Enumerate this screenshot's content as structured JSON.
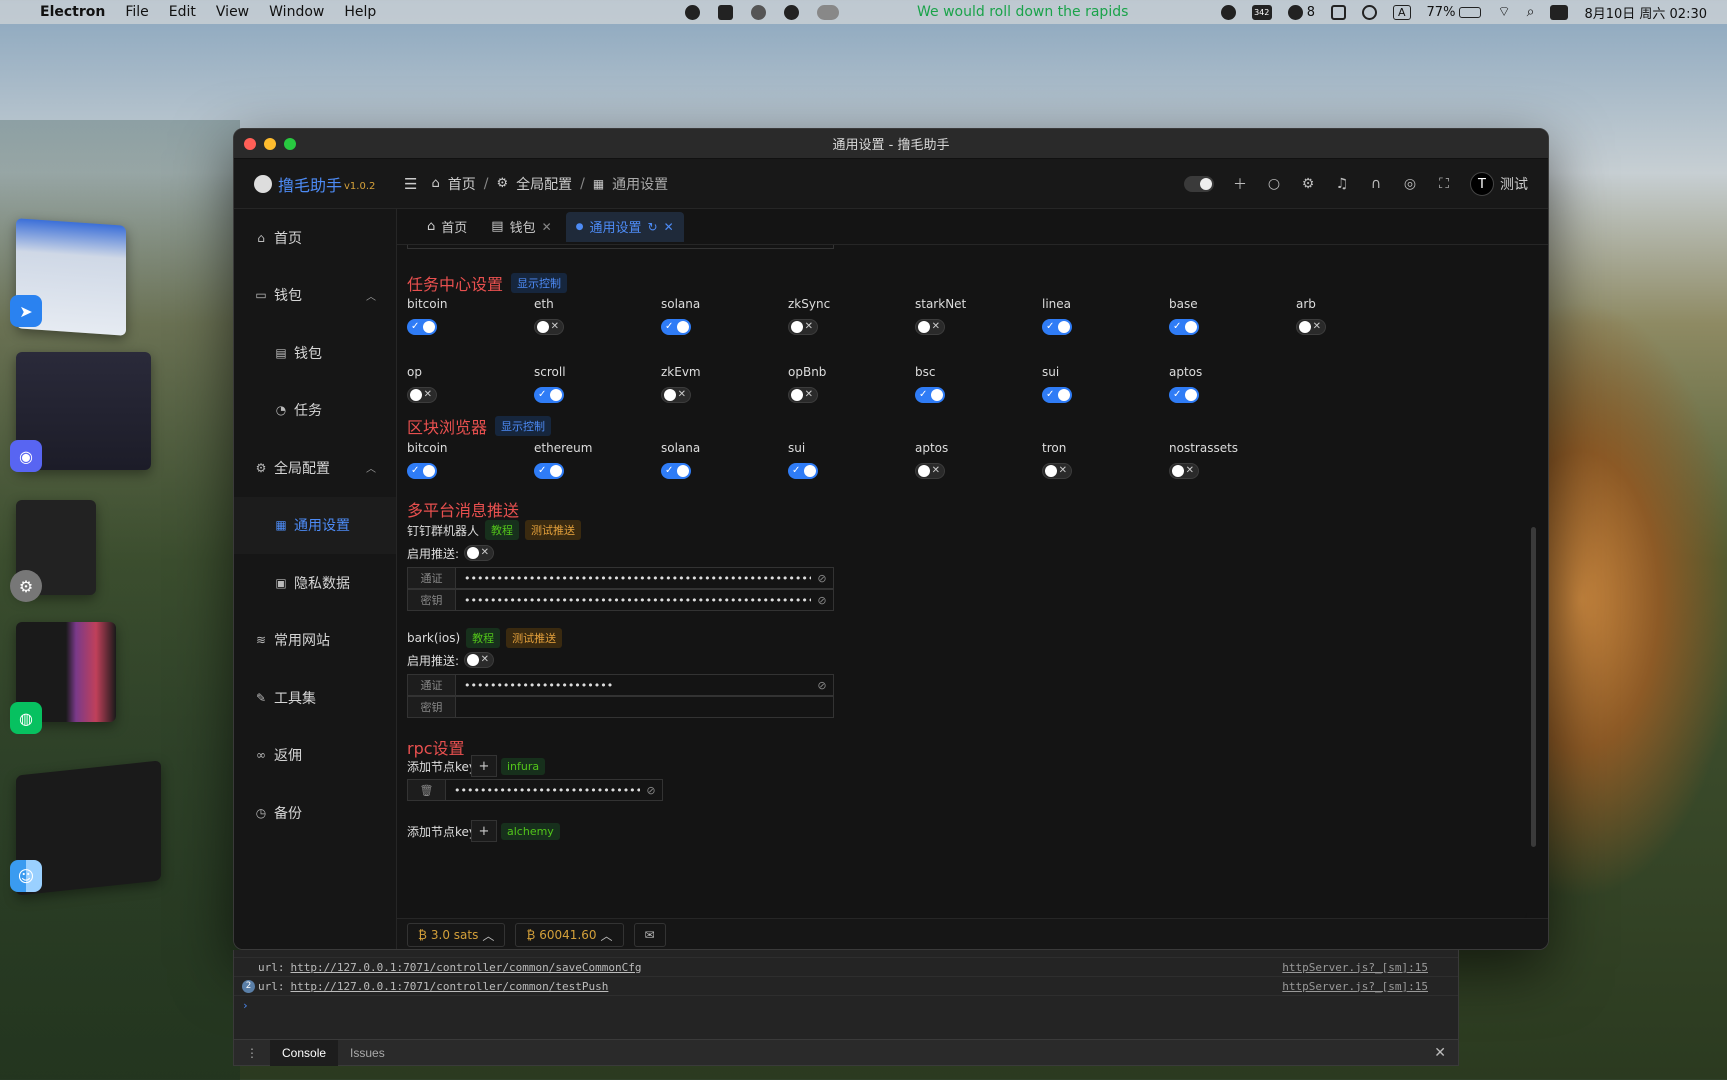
{
  "menubar": {
    "app": "Electron",
    "items": [
      "File",
      "Edit",
      "View",
      "Window",
      "Help"
    ],
    "ticker": "We would roll down the rapids",
    "wechat_count": "8",
    "badge_count": "342",
    "input_indicator": "A",
    "battery": "77%",
    "datetime": "8月10日 周六 02:30"
  },
  "window": {
    "title": "通用设置 - 撸毛助手"
  },
  "header": {
    "app_name": "撸毛助手",
    "version": "v1.0.2",
    "breadcrumb": [
      "首页",
      "全局配置",
      "通用设置"
    ],
    "user_initial": "T",
    "user_name": "测试"
  },
  "sidebar": {
    "items": [
      {
        "label": "首页",
        "icon": "home-icon"
      },
      {
        "label": "钱包",
        "icon": "wallet-icon",
        "expanded": true
      },
      {
        "label": "钱包",
        "icon": "doc-icon"
      },
      {
        "label": "任务",
        "icon": "task-icon"
      },
      {
        "label": "全局配置",
        "icon": "gear-icon",
        "expanded": true
      },
      {
        "label": "通用设置",
        "icon": "grid-icon",
        "active": true
      },
      {
        "label": "隐私数据",
        "icon": "privacy-icon"
      },
      {
        "label": "常用网站",
        "icon": "site-icon"
      },
      {
        "label": "工具集",
        "icon": "tool-icon"
      },
      {
        "label": "返佣",
        "icon": "link-icon"
      },
      {
        "label": "备份",
        "icon": "clock-icon"
      }
    ]
  },
  "tabs": [
    {
      "label": "首页"
    },
    {
      "label": "钱包"
    },
    {
      "label": "通用设置",
      "active": true
    }
  ],
  "task_center": {
    "title": "任务中心设置",
    "tag": "显示控制",
    "row1": [
      {
        "name": "bitcoin",
        "on": true
      },
      {
        "name": "eth",
        "on": false
      },
      {
        "name": "solana",
        "on": true
      },
      {
        "name": "zkSync",
        "on": false
      },
      {
        "name": "starkNet",
        "on": false
      },
      {
        "name": "linea",
        "on": true
      },
      {
        "name": "base",
        "on": true
      },
      {
        "name": "arb",
        "on": false
      }
    ],
    "row2": [
      {
        "name": "op",
        "on": false
      },
      {
        "name": "scroll",
        "on": true
      },
      {
        "name": "zkEvm",
        "on": false
      },
      {
        "name": "opBnb",
        "on": false
      },
      {
        "name": "bsc",
        "on": true
      },
      {
        "name": "sui",
        "on": true
      },
      {
        "name": "aptos",
        "on": true
      }
    ]
  },
  "explorer": {
    "title": "区块浏览器",
    "tag": "显示控制",
    "items": [
      {
        "name": "bitcoin",
        "on": true
      },
      {
        "name": "ethereum",
        "on": true
      },
      {
        "name": "solana",
        "on": true
      },
      {
        "name": "sui",
        "on": true
      },
      {
        "name": "aptos",
        "on": false
      },
      {
        "name": "tron",
        "on": false
      },
      {
        "name": "nostrassets",
        "on": false
      }
    ]
  },
  "push": {
    "title": "多平台消息推送",
    "dingtalk": {
      "label": "钉钉群机器人",
      "tutorial": "教程",
      "test": "测试推送",
      "enable_label": "启用推送:",
      "enabled": false,
      "token_label": "通证",
      "token_value": "•••••••••••••••••••••••••••••••••••••••••••••••••••••••••••••••••",
      "secret_label": "密钥",
      "secret_value": "•••••••••••••••••••••••••••••••••••••••••••••••••••••••••••••••••••••"
    },
    "bark": {
      "label": "bark(ios)",
      "tutorial": "教程",
      "test": "测试推送",
      "enable_label": "启用推送:",
      "enabled": false,
      "token_label": "通证",
      "token_value": "•••••••••••••••••••••••",
      "secret_label": "密钥",
      "secret_value": ""
    }
  },
  "rpc": {
    "title": "rpc设置",
    "add_label": "添加节点key",
    "plus": "+",
    "infura": "infura",
    "infura_value": "••••••••••••••••••••••••••••••••",
    "add_label2": "添加节点key",
    "alchemy": "alchemy"
  },
  "footer": {
    "sats": "3.0 sats",
    "btc_price": "60041.60"
  },
  "devtools": {
    "lines": [
      {
        "prefix": "url:",
        "url": "http://127.0.0.1:7071/controller/common/saveCommonCfg",
        "src": "httpServer.js?_[sm]:15"
      },
      {
        "prefix": "url:",
        "url": "http://127.0.0.1:7071/controller/common/testPush",
        "src": "httpServer.js?_[sm]:15",
        "count": "2"
      }
    ],
    "tabs": [
      "Console",
      "Issues"
    ]
  }
}
